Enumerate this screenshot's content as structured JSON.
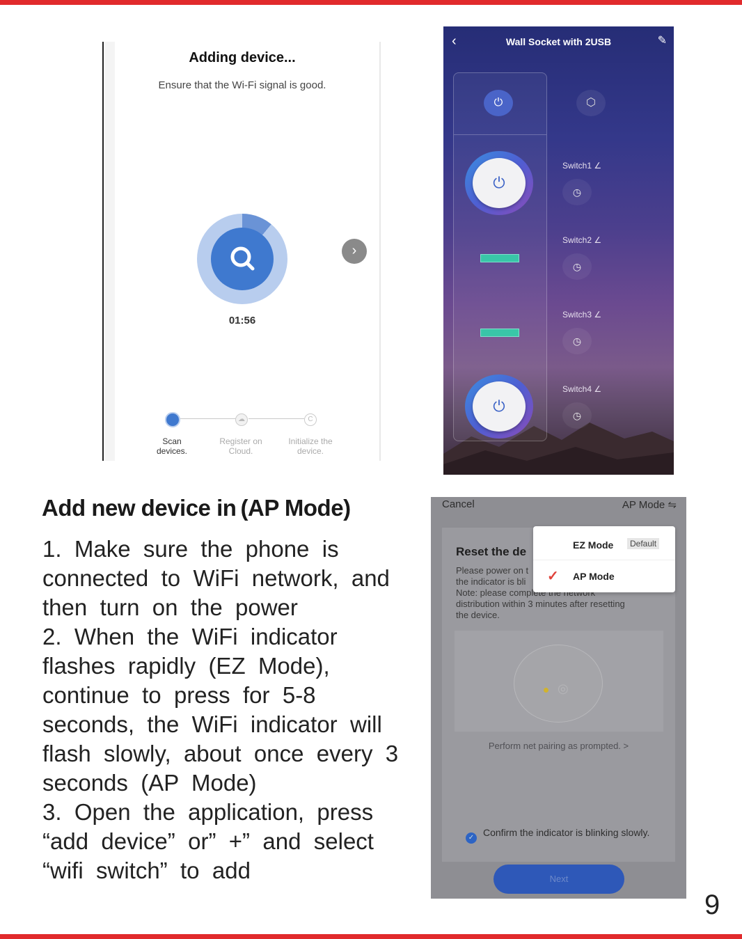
{
  "page_number": "9",
  "adding_device": {
    "title": "Adding device...",
    "subtitle": "Ensure that the Wi-Fi signal is good.",
    "timer": "01:56",
    "steps": [
      {
        "label_line1": "Scan",
        "label_line2": "devices."
      },
      {
        "label_line1": "Register on",
        "label_line2": "Cloud."
      },
      {
        "label_line1": "Initialize the",
        "label_line2": "device."
      }
    ]
  },
  "wall_socket": {
    "title": "Wall Socket with 2USB",
    "switches": [
      "Switch1",
      "Switch2",
      "Switch3",
      "Switch4"
    ]
  },
  "section": {
    "heading": "Add new device in (AP Mode)",
    "lines": [
      "1.  Make  sure  the  phone  is",
      "connected  to  WiFi  network,  and",
      "then  turn  on  the  power",
      "2.  When  the  WiFi  indicator",
      "flashes  rapidly  (EZ  Mode),",
      "continue  to  press  for  5-8",
      "seconds,  the  WiFi  indicator  will",
      "flash  slowly,  about  once  every  3",
      "seconds  (AP  Mode)",
      "3.  Open  the  application,  press",
      "“add  device”  or”  +”  and  select",
      "“wifi  switch”  to  add"
    ]
  },
  "ap_mode_screen": {
    "cancel": "Cancel",
    "mode_selector": "AP Mode ⇋",
    "reset_title": "Reset the de",
    "para_line1": "Please power on t",
    "para_line2": "the indicator is bli",
    "para_line3": "Note: please complete the network",
    "para_line4": "distribution within 3 minutes after resetting",
    "para_line5": "the device.",
    "perform": "Perform net pairing as prompted. >",
    "confirm": "Confirm the indicator is blinking slowly.",
    "next": "Next",
    "popup": {
      "ez_mode": "EZ Mode",
      "default": "Default",
      "ap_mode": "AP Mode"
    }
  },
  "colors": {
    "accent_red": "#e12a2c",
    "teal": "#39c6a8",
    "blue": "#3f79cf"
  }
}
